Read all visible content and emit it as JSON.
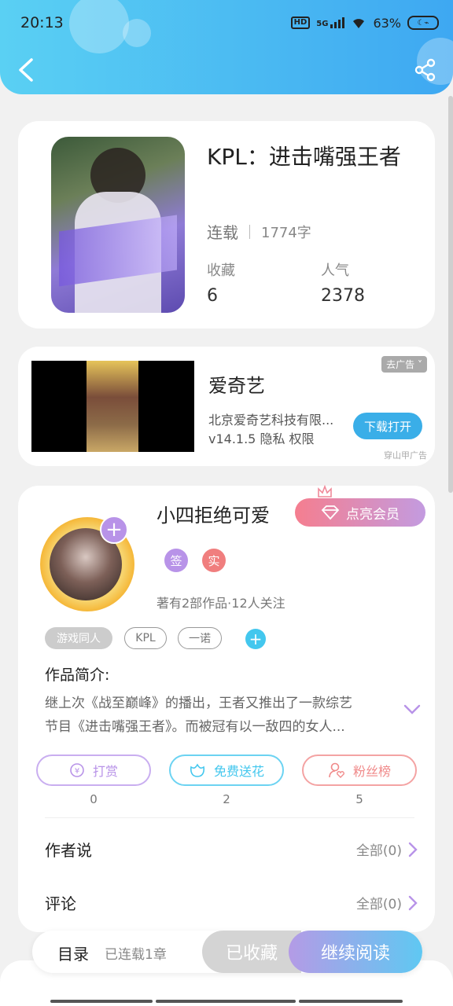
{
  "status_bar": {
    "time": "20:13",
    "hd": "HD",
    "network": "5G",
    "battery": "63%"
  },
  "book": {
    "title": "KPL：进击嘴强王者",
    "status": "连载",
    "word_count": "1774字",
    "favorites_label": "收藏",
    "favorites_value": "6",
    "popularity_label": "人气",
    "popularity_value": "2378"
  },
  "ad": {
    "app_name": "爱奇艺",
    "company": "北京爱奇艺科技有限...",
    "meta": "v14.1.5  隐私  权限",
    "close_label": "去广告",
    "download_label": "下载打开",
    "source": "穿山甲广告"
  },
  "author": {
    "name": "小四拒绝可爱",
    "vip_label": "点亮会员",
    "badge_sign": "签",
    "badge_real": "实",
    "works": "著有2部作品·12人关注",
    "tags": [
      "游戏同人",
      "KPL",
      "一诺"
    ]
  },
  "intro": {
    "label": "作品简介:",
    "text_line1": "继上次《战至巅峰》的播出，王者又推出了一款综艺",
    "text_line2": "节目《进击嘴强王者》。而被冠有以一敌四的女人..."
  },
  "actions": {
    "reward_label": "打赏",
    "reward_count": "0",
    "flower_label": "免费送花",
    "flower_count": "2",
    "fans_label": "粉丝榜",
    "fans_count": "5"
  },
  "author_says": {
    "title": "作者说",
    "right": "全部(0)"
  },
  "comments": {
    "title": "评论",
    "right": "全部(0)"
  },
  "bottom": {
    "toc_label": "目录",
    "chapter_count": "已连载1章",
    "collected_label": "已收藏",
    "continue_label": "继续阅读"
  },
  "colors": {
    "header_start": "#5ad0f3",
    "header_end": "#3ea8f2",
    "reward": "#b893e8",
    "flower": "#43c7ee",
    "fans": "#f08a8a",
    "badge_sign": "#b893e8",
    "badge_real": "#f07e7e"
  }
}
